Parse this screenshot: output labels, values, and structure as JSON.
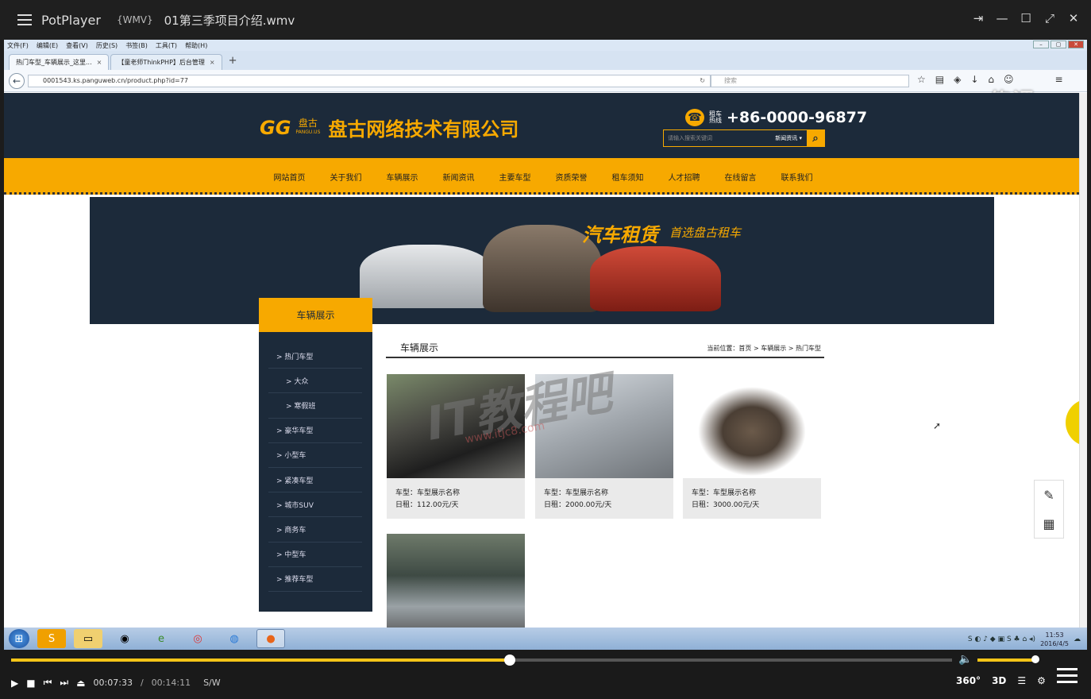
{
  "player": {
    "app_name": "PotPlayer",
    "format": "{WMV}",
    "file_name": "01第三季项目介绍.wmv",
    "current_time": "00:07:33",
    "separator": "/",
    "total_time": "00:14:11",
    "mode": "S/W",
    "progress_fraction": 0.53,
    "volume_fraction": 0.99,
    "btn_360": "360°",
    "btn_3d": "3D",
    "accent_color": "#f5c518"
  },
  "browser": {
    "menu": [
      "文件(F)",
      "编辑(E)",
      "查看(V)",
      "历史(S)",
      "书签(B)",
      "工具(T)",
      "帮助(H)"
    ],
    "tabs": [
      {
        "label": "热门车型_车辆展示_这里..."
      },
      {
        "label": "【童老师ThinkPHP】后台管理"
      }
    ],
    "new_tab": "+",
    "url": "0001543.ks.panguweb.cn/product.php?id=77",
    "search_placeholder": "搜索",
    "watermark": "传课"
  },
  "site": {
    "logo_mark": "GG",
    "logo_small": "盘古",
    "logo_small_en": "PANGU.US",
    "company_name": "盘古网络技术有限公司",
    "hotline_label_1": "租车",
    "hotline_label_2": "热线",
    "hotline": "+86-0000-96877",
    "search_placeholder": "请输入搜索关键词",
    "search_category": "新闻资讯",
    "nav": [
      "网站首页",
      "关于我们",
      "车辆展示",
      "新闻资讯",
      "主要车型",
      "资质荣誉",
      "租车须知",
      "人才招聘",
      "在线留言",
      "联系我们"
    ],
    "banner_slogan": "汽车租赁",
    "banner_slogan2": "首选盘古租车",
    "sidebar_title": "车辆展示",
    "sidebar_items": [
      {
        "label": "> 热门车型",
        "sub": false
      },
      {
        "label": "> 大众",
        "sub": true
      },
      {
        "label": "> 寒假班",
        "sub": true
      },
      {
        "label": "> 豪华车型",
        "sub": false
      },
      {
        "label": "> 小型车",
        "sub": false
      },
      {
        "label": "> 紧凑车型",
        "sub": false
      },
      {
        "label": "> 城市SUV",
        "sub": false
      },
      {
        "label": "> 商务车",
        "sub": false
      },
      {
        "label": "> 中型车",
        "sub": false
      },
      {
        "label": "> 推荐车型",
        "sub": false
      }
    ],
    "main_title": "车辆展示",
    "breadcrumb": "当前位置：首页 > 车辆展示 > 热门车型",
    "cards": [
      {
        "model": "车型：车型展示名称",
        "rent": "日租：112.00元/天"
      },
      {
        "model": "车型：车型展示名称",
        "rent": "日租：2000.00元/天"
      },
      {
        "model": "车型：车型展示名称",
        "rent": "日租：3000.00元/天"
      }
    ],
    "brand_color": "#f7a900",
    "dark_color": "#1c2a3a"
  },
  "overlay_watermark": "IT教程吧",
  "overlay_watermark_url": "www.itjc8.com",
  "taskbar": {
    "time": "11:53",
    "date": "2016/4/5"
  }
}
